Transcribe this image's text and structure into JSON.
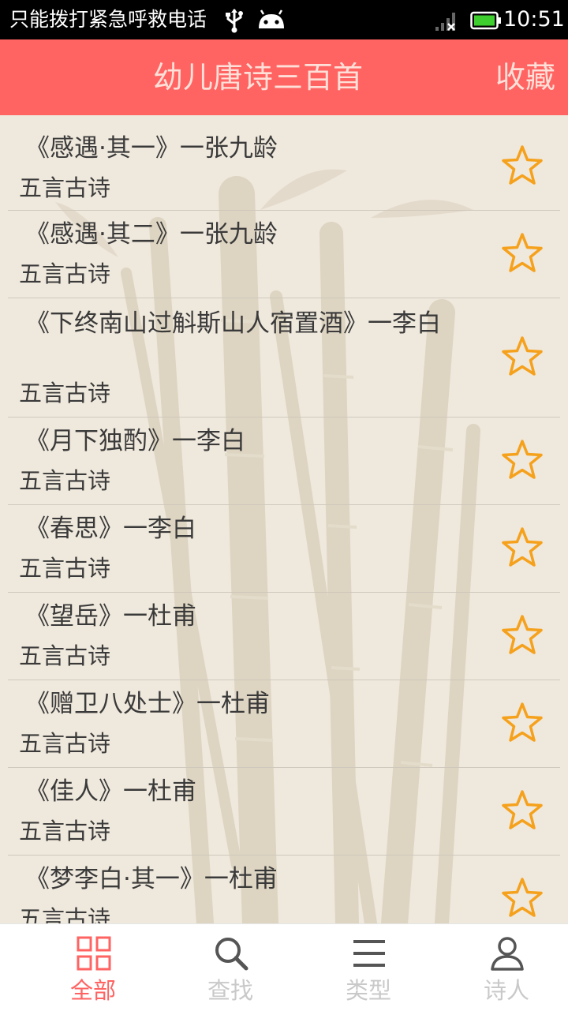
{
  "status_bar": {
    "notification_text": "只能拨打紧急呼救电话",
    "time": "10:51",
    "icons": [
      "usb-icon",
      "android-icon",
      "signal-icon",
      "battery-icon"
    ]
  },
  "header": {
    "title": "幼儿唐诗三百首",
    "favorites_label": "收藏"
  },
  "poems": [
    {
      "title": "《感遇·其一》一张九龄",
      "type": "五言古诗"
    },
    {
      "title": "《感遇·其二》一张九龄",
      "type": "五言古诗"
    },
    {
      "title": "《下终南山过斛斯山人宿置酒》一李白",
      "type": "五言古诗"
    },
    {
      "title": "《月下独酌》一李白",
      "type": "五言古诗"
    },
    {
      "title": "《春思》一李白",
      "type": "五言古诗"
    },
    {
      "title": "《望岳》一杜甫",
      "type": "五言古诗"
    },
    {
      "title": "《赠卫八处士》一杜甫",
      "type": "五言古诗"
    },
    {
      "title": "《佳人》一杜甫",
      "type": "五言古诗"
    },
    {
      "title": "《梦李白·其一》一杜甫",
      "type": "五言古诗"
    }
  ],
  "bottom_nav": {
    "items": [
      {
        "label": "全部",
        "icon": "grid-icon",
        "active": true
      },
      {
        "label": "查找",
        "icon": "search-icon",
        "active": false
      },
      {
        "label": "类型",
        "icon": "list-icon",
        "active": false
      },
      {
        "label": "诗人",
        "icon": "person-icon",
        "active": false
      }
    ]
  },
  "colors": {
    "header": "#ff6362",
    "header_text": "#ffe0d8",
    "background": "#efe8dc",
    "star": "#f5a11c",
    "nav_active": "#ff6362",
    "nav_inactive": "#c9c9c9"
  }
}
